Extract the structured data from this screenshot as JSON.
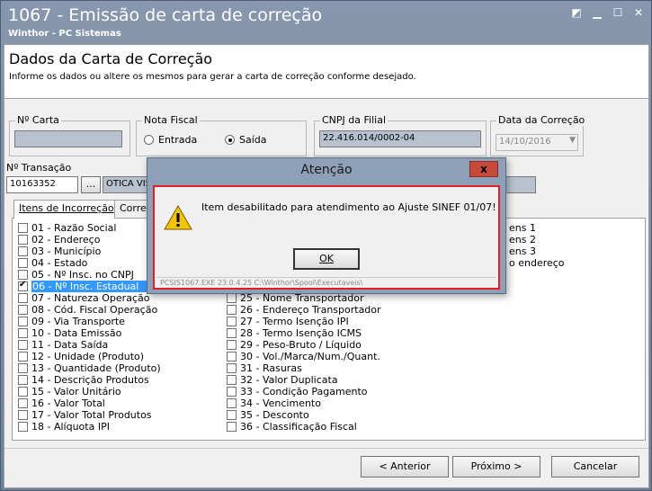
{
  "window": {
    "title": "1067 - Emissão de carta de correção",
    "subtitle": "Winthor - PC Sistemas",
    "controls": [
      "restore-icon",
      "minimize-icon",
      "maximize-icon",
      "close-icon"
    ]
  },
  "header": {
    "title": "Dados da Carta de Correção",
    "description": "Informe os dados ou altere os mesmos para gerar a carta de correção conforme desejado."
  },
  "form": {
    "num_carta_label": "Nº Carta",
    "num_carta_value": "",
    "nota_fiscal_label": "Nota Fiscal",
    "entrada_label": "Entrada",
    "saida_label": "Saída",
    "selected_nf": "Saída",
    "cnpj_label": "CNPJ da Filial",
    "cnpj_value": "22.416.014/0002-04",
    "data_label": "Data da Correção",
    "data_value": "14/10/2016",
    "transacao_label": "Nº Transação",
    "transacao_value": "10163352",
    "browse_label": "...",
    "cliente_value": "OTICA VIS"
  },
  "tabs": [
    {
      "label": "Itens de Incorreção",
      "active": true
    },
    {
      "label": "Corre",
      "active": false
    }
  ],
  "items_left": [
    {
      "label": "01 - Razão Social",
      "checked": false
    },
    {
      "label": "02 - Endereço",
      "checked": false
    },
    {
      "label": "03 - Município",
      "checked": false
    },
    {
      "label": "04 - Estado",
      "checked": false
    },
    {
      "label": "05 - Nº Insc. no CNPJ",
      "checked": false
    },
    {
      "label": "06 - Nº Insc. Estadual",
      "checked": true
    },
    {
      "label": "07 - Natureza Operação",
      "checked": false
    },
    {
      "label": "08 - Cód. Fiscal Operação",
      "checked": false
    },
    {
      "label": "09 - Via Transporte",
      "checked": false
    },
    {
      "label": "10 - Data Emissão",
      "checked": false
    },
    {
      "label": "11 - Data Saída",
      "checked": false
    },
    {
      "label": "12 - Unidade (Produto)",
      "checked": false
    },
    {
      "label": "13 - Quantidade (Produto)",
      "checked": false
    },
    {
      "label": "14 - Descrição Produtos",
      "checked": false
    },
    {
      "label": "15 - Valor Unitário",
      "checked": false
    },
    {
      "label": "16 - Valor Total",
      "checked": false
    },
    {
      "label": "17 - Valor Total Produtos",
      "checked": false
    },
    {
      "label": "18 - Alíquota IPI",
      "checked": false
    }
  ],
  "items_middle": [
    {
      "label": "25 - Nome Transportador",
      "checked": false
    },
    {
      "label": "26 - Endereço Transportador",
      "checked": false
    },
    {
      "label": "27 - Termo Isenção IPI",
      "checked": false
    },
    {
      "label": "28 - Termo Isenção ICMS",
      "checked": false
    },
    {
      "label": "29 - Peso-Bruto / Líquido",
      "checked": false
    },
    {
      "label": "30 - Vol./Marca/Num./Quant.",
      "checked": false
    },
    {
      "label": "31 - Rasuras",
      "checked": false
    },
    {
      "label": "32 - Valor Duplicata",
      "checked": false
    },
    {
      "label": "33 - Condição Pagamento",
      "checked": false
    },
    {
      "label": "34 - Vencimento",
      "checked": false
    },
    {
      "label": "35 - Desconto",
      "checked": false
    },
    {
      "label": "36 - Classificação Fiscal",
      "checked": false
    }
  ],
  "items_right": [
    {
      "label": "ens 1"
    },
    {
      "label": "ens 2"
    },
    {
      "label": "ens 3"
    },
    {
      "label": "o endereço"
    }
  ],
  "buttons": {
    "anterior": "< Anterior",
    "proximo": "Próximo >",
    "cancelar": "Cancelar"
  },
  "dialog": {
    "title": "Atenção",
    "close": "x",
    "message": "Item desabilitado para atendimento ao Ajuste SINEF 01/07!",
    "ok": "OK",
    "status": "PCSIS1067.EXE 23.0.4.25 C:\\Winthor\\Spool\\Executaveis\\"
  }
}
